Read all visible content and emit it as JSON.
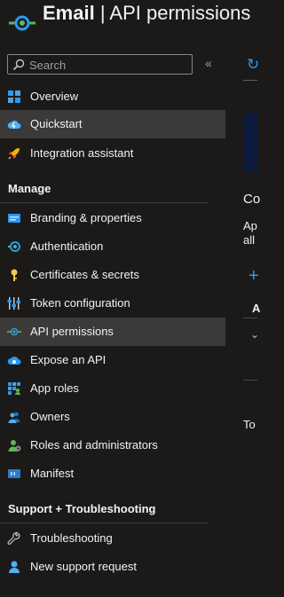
{
  "header": {
    "title_bold": "Email",
    "title_rest": " | API permissions"
  },
  "search": {
    "placeholder": "Search"
  },
  "collapse_glyph": "«",
  "nav_top": [
    {
      "label": "Overview",
      "icon": "overview-icon"
    },
    {
      "label": "Quickstart",
      "icon": "quickstart-icon"
    },
    {
      "label": "Integration assistant",
      "icon": "rocket-icon"
    }
  ],
  "section_manage": "Manage",
  "nav_manage": [
    {
      "label": "Branding & properties",
      "icon": "branding-icon"
    },
    {
      "label": "Authentication",
      "icon": "authentication-icon"
    },
    {
      "label": "Certificates & secrets",
      "icon": "key-icon"
    },
    {
      "label": "Token configuration",
      "icon": "token-config-icon"
    },
    {
      "label": "API permissions",
      "icon": "api-permissions-icon"
    },
    {
      "label": "Expose an API",
      "icon": "cloud-icon"
    },
    {
      "label": "App roles",
      "icon": "app-roles-icon"
    },
    {
      "label": "Owners",
      "icon": "owners-icon"
    },
    {
      "label": "Roles and administrators",
      "icon": "roles-admin-icon"
    },
    {
      "label": "Manifest",
      "icon": "manifest-icon"
    }
  ],
  "section_support": "Support + Troubleshooting",
  "nav_support": [
    {
      "label": "Troubleshooting",
      "icon": "wrench-icon"
    },
    {
      "label": "New support request",
      "icon": "support-person-icon"
    }
  ],
  "right": {
    "heading": "Co",
    "line1": "Ap",
    "line2": "all",
    "col_header": "A",
    "footer_text": "To"
  },
  "colors": {
    "accent": "#2899f5",
    "background": "#1b1a19",
    "active": "#3b3a39"
  }
}
